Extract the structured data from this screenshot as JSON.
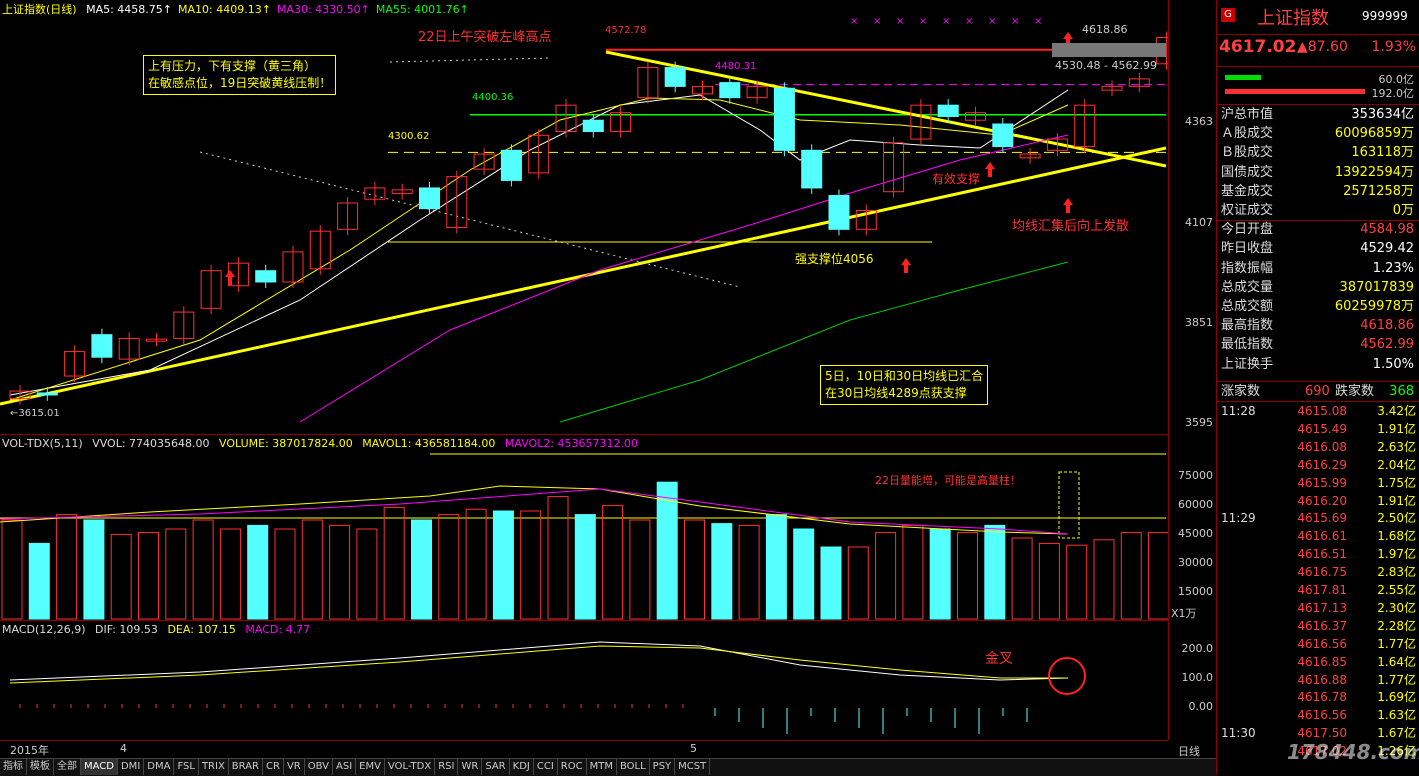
{
  "title": "上证指数(日线)",
  "ma": [
    {
      "label": "MA5:",
      "value": "4458.75",
      "color": "#ffffff"
    },
    {
      "label": "MA10:",
      "value": "4409.13",
      "color": "#ffff00"
    },
    {
      "label": "MA30:",
      "value": "4330.50",
      "color": "#ff00ff"
    },
    {
      "label": "MA55:",
      "value": "4001.76",
      "color": "#00ff00"
    }
  ],
  "price_axis": [
    "4363",
    "4107",
    "3851",
    "3595"
  ],
  "price_levels": {
    "high": "4572.78",
    "p4480": "4480.31",
    "p4400": "4400.36",
    "p4300": "4300.62",
    "low": "3615.01",
    "right_high": "4618.86",
    "right_range": "4530.48 - 4562.99"
  },
  "annotations": {
    "breakout": "22日上午突破左峰高点",
    "box_line1": "上有压力，下有支撑（黄三角）",
    "box_line2": "在敏感点位，19日突破黄线压制！",
    "support": "有效支撑",
    "ma_gather": "均线汇集后向上发散",
    "strong_support": "强支撑位4056",
    "box2_line1": "5日，10日和30日均线已汇合",
    "box2_line2": "在30日均线4289点获支撑",
    "volume_note": "22日量能增，可能是高量柱！",
    "golden_cross": "金叉"
  },
  "vol": {
    "name": "VOL-TDX(5,11)",
    "vvol": "VVOL: 774035648.00",
    "volume": "VOLUME: 387017824.00",
    "mavol1": "MAVOL1: 436581184.00",
    "mavol2": "MAVOL2: 453657312.00",
    "axis": [
      "75000",
      "60000",
      "45000",
      "30000",
      "15000"
    ],
    "unit": "X1万"
  },
  "macd": {
    "name": "MACD(12,26,9)",
    "dif": "DIF: 109.53",
    "dea": "DEA: 107.15",
    "macd": "MACD: 4.77",
    "axis": [
      "200.0",
      "100.0",
      "0.00"
    ]
  },
  "xaxis": {
    "year": "2015年",
    "m4": "4",
    "m5": "5",
    "period": "日线"
  },
  "quote": {
    "name": "上证指数",
    "code": "999999",
    "price": "4617.02",
    "change": "▲87.60",
    "pct": "1.93%",
    "bar1": "60.0亿",
    "bar2": "192.0亿"
  },
  "stats": [
    {
      "k": "沪总市值",
      "v": "353634亿",
      "c": "#ffffff"
    },
    {
      "k": "Ａ股成交",
      "v": "60096859万",
      "c": "#ffff00"
    },
    {
      "k": "Ｂ股成交",
      "v": "163118万",
      "c": "#ffff00"
    },
    {
      "k": "国债成交",
      "v": "13922594万",
      "c": "#ffff00"
    },
    {
      "k": "基金成交",
      "v": "2571258万",
      "c": "#ffff00"
    },
    {
      "k": "权证成交",
      "v": "0万",
      "c": "#ffff00"
    },
    {
      "k": "今日开盘",
      "v": "4584.98",
      "c": "#ff4040"
    },
    {
      "k": "昨日收盘",
      "v": "4529.42",
      "c": "#ffffff"
    },
    {
      "k": "指数振幅",
      "v": "1.23%",
      "c": "#ffffff"
    },
    {
      "k": "总成交量",
      "v": "387017839",
      "c": "#ffff00"
    },
    {
      "k": "总成交额",
      "v": "60259978万",
      "c": "#ffff00"
    },
    {
      "k": "最高指数",
      "v": "4618.86",
      "c": "#ff4040"
    },
    {
      "k": "最低指数",
      "v": "4562.99",
      "c": "#ff4040"
    },
    {
      "k": "上证换手",
      "v": "1.50%",
      "c": "#ffffff"
    }
  ],
  "breadth": {
    "up_label": "涨家数",
    "up": "690",
    "down_label": "跌家数",
    "down": "368"
  },
  "ticks": [
    {
      "t": "11:28",
      "p": "4615.08",
      "a": "3.42亿"
    },
    {
      "t": "",
      "p": "4615.49",
      "a": "1.91亿"
    },
    {
      "t": "",
      "p": "4616.08",
      "a": "2.63亿"
    },
    {
      "t": "",
      "p": "4616.29",
      "a": "2.04亿"
    },
    {
      "t": "",
      "p": "4615.99",
      "a": "1.75亿"
    },
    {
      "t": "",
      "p": "4616.20",
      "a": "1.91亿"
    },
    {
      "t": "11:29",
      "p": "4615.69",
      "a": "2.50亿"
    },
    {
      "t": "",
      "p": "4616.61",
      "a": "1.68亿"
    },
    {
      "t": "",
      "p": "4616.51",
      "a": "1.97亿"
    },
    {
      "t": "",
      "p": "4616.75",
      "a": "2.83亿"
    },
    {
      "t": "",
      "p": "4617.81",
      "a": "2.55亿"
    },
    {
      "t": "",
      "p": "4617.13",
      "a": "2.30亿"
    },
    {
      "t": "",
      "p": "4616.37",
      "a": "2.28亿"
    },
    {
      "t": "",
      "p": "4616.56",
      "a": "1.77亿"
    },
    {
      "t": "",
      "p": "4616.85",
      "a": "1.64亿"
    },
    {
      "t": "",
      "p": "4616.88",
      "a": "1.77亿"
    },
    {
      "t": "",
      "p": "4616.78",
      "a": "1.69亿"
    },
    {
      "t": "",
      "p": "4616.56",
      "a": "1.63亿"
    },
    {
      "t": "11:30",
      "p": "4617.50",
      "a": "1.67亿"
    },
    {
      "t": "",
      "p": "4617.02",
      "a": "1.26亿"
    }
  ],
  "tabs": [
    "指标",
    "模板",
    "全部",
    "MACD",
    "DMI",
    "DMA",
    "FSL",
    "TRIX",
    "BRAR",
    "CR",
    "VR",
    "OBV",
    "ASI",
    "EMV",
    "VOL-TDX",
    "RSI",
    "WR",
    "SAR",
    "KDJ",
    "CCI",
    "ROC",
    "MTM",
    "BOLL",
    "PSY",
    "MCST"
  ],
  "selected_tab": "MACD",
  "watermark": "178448.com",
  "chart_data": {
    "type": "candlestick",
    "title": "上证指数(日线)",
    "y_range": [
      3595,
      4620
    ],
    "candles": [
      {
        "o": 3640,
        "c": 3660,
        "up": true
      },
      {
        "o": 3655,
        "c": 3650,
        "up": false
      },
      {
        "o": 3700,
        "c": 3765,
        "up": true
      },
      {
        "o": 3810,
        "c": 3750,
        "up": false
      },
      {
        "o": 3745,
        "c": 3800,
        "up": true
      },
      {
        "o": 3795,
        "c": 3798,
        "up": true
      },
      {
        "o": 3800,
        "c": 3870,
        "up": true
      },
      {
        "o": 3880,
        "c": 3980,
        "up": true
      },
      {
        "o": 3940,
        "c": 4000,
        "up": true
      },
      {
        "o": 3980,
        "c": 3950,
        "up": false
      },
      {
        "o": 3950,
        "c": 4030,
        "up": true
      },
      {
        "o": 3985,
        "c": 4085,
        "up": true
      },
      {
        "o": 4090,
        "c": 4160,
        "up": true
      },
      {
        "o": 4170,
        "c": 4200,
        "up": true
      },
      {
        "o": 4185,
        "c": 4195,
        "up": true
      },
      {
        "o": 4200,
        "c": 4145,
        "up": false
      },
      {
        "o": 4095,
        "c": 4230,
        "up": true
      },
      {
        "o": 4250,
        "c": 4290,
        "up": true
      },
      {
        "o": 4300,
        "c": 4220,
        "up": false
      },
      {
        "o": 4240,
        "c": 4340,
        "up": true
      },
      {
        "o": 4350,
        "c": 4420,
        "up": true
      },
      {
        "o": 4380,
        "c": 4350,
        "up": false
      },
      {
        "o": 4350,
        "c": 4400,
        "up": true
      },
      {
        "o": 4440,
        "c": 4520,
        "up": true
      },
      {
        "o": 4520,
        "c": 4470,
        "up": false
      },
      {
        "o": 4470,
        "c": 4450,
        "up": true
      },
      {
        "o": 4480,
        "c": 4440,
        "up": false
      },
      {
        "o": 4440,
        "c": 4470,
        "up": true
      },
      {
        "o": 4465,
        "c": 4300,
        "up": false
      },
      {
        "o": 4300,
        "c": 4200,
        "up": false
      },
      {
        "o": 4180,
        "c": 4090,
        "up": false
      },
      {
        "o": 4090,
        "c": 4140,
        "up": true
      },
      {
        "o": 4190,
        "c": 4320,
        "up": true
      },
      {
        "o": 4330,
        "c": 4420,
        "up": true
      },
      {
        "o": 4420,
        "c": 4390,
        "up": false
      },
      {
        "o": 4380,
        "c": 4400,
        "up": true
      },
      {
        "o": 4370,
        "c": 4310,
        "up": false
      },
      {
        "o": 4290,
        "c": 4280,
        "up": true
      },
      {
        "o": 4300,
        "c": 4330,
        "up": true
      },
      {
        "o": 4310,
        "c": 4420,
        "up": true
      },
      {
        "o": 4470,
        "c": 4460,
        "up": true
      },
      {
        "o": 4490,
        "c": 4470,
        "up": true
      },
      {
        "o": 4530,
        "c": 4600,
        "up": true
      },
      {
        "o": 4585,
        "c": 4617,
        "up": true
      }
    ],
    "volume": [
      55,
      42,
      58,
      55,
      47,
      48,
      50,
      55,
      50,
      52,
      50,
      55,
      52,
      50,
      62,
      55,
      58,
      61,
      60,
      60,
      68,
      58,
      63,
      55,
      76,
      55,
      53,
      52,
      58,
      50,
      40,
      40,
      48,
      52,
      50,
      48,
      52,
      45,
      42,
      41,
      44,
      48,
      48,
      40
    ],
    "volume_up": [
      true,
      false,
      true,
      false,
      true,
      true,
      true,
      true,
      true,
      false,
      true,
      true,
      true,
      true,
      true,
      false,
      true,
      true,
      false,
      true,
      true,
      false,
      true,
      true,
      false,
      true,
      false,
      true,
      false,
      false,
      false,
      true,
      true,
      true,
      false,
      true,
      false,
      true,
      true,
      true,
      true,
      true,
      true,
      true
    ]
  }
}
